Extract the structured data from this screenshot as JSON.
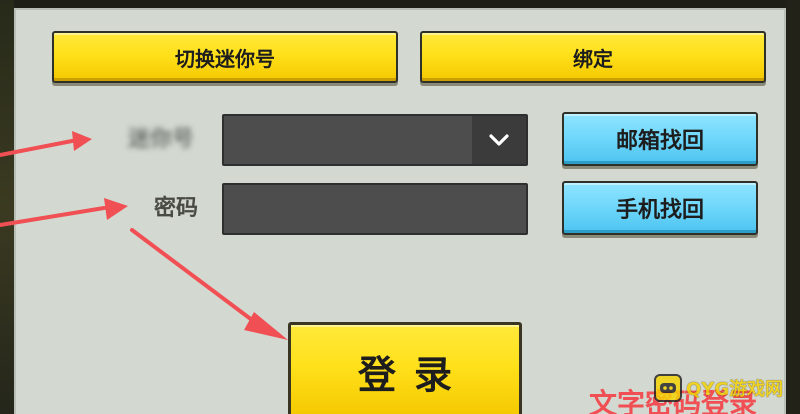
{
  "top_buttons": {
    "switch_mini": "切换迷你号",
    "bind": "绑定"
  },
  "form": {
    "account_label": "迷你号",
    "account_value": "",
    "password_label": "密码",
    "password_value": ""
  },
  "side_buttons": {
    "email_recovery": "邮箱找回",
    "phone_recovery": "手机找回"
  },
  "login": {
    "label": "登录"
  },
  "overlay": {
    "caption": "文字密码登录",
    "watermark": "QYG游戏网"
  },
  "colors": {
    "panel": "#d3d9d0",
    "yellow": "#ffe01a",
    "cyan": "#6fd7fb",
    "input": "#4d4d4d",
    "arrow": "#f04f54"
  },
  "icons": {
    "dropdown": "chevron-down-icon",
    "watermark_logo": "game-controller-icon"
  }
}
